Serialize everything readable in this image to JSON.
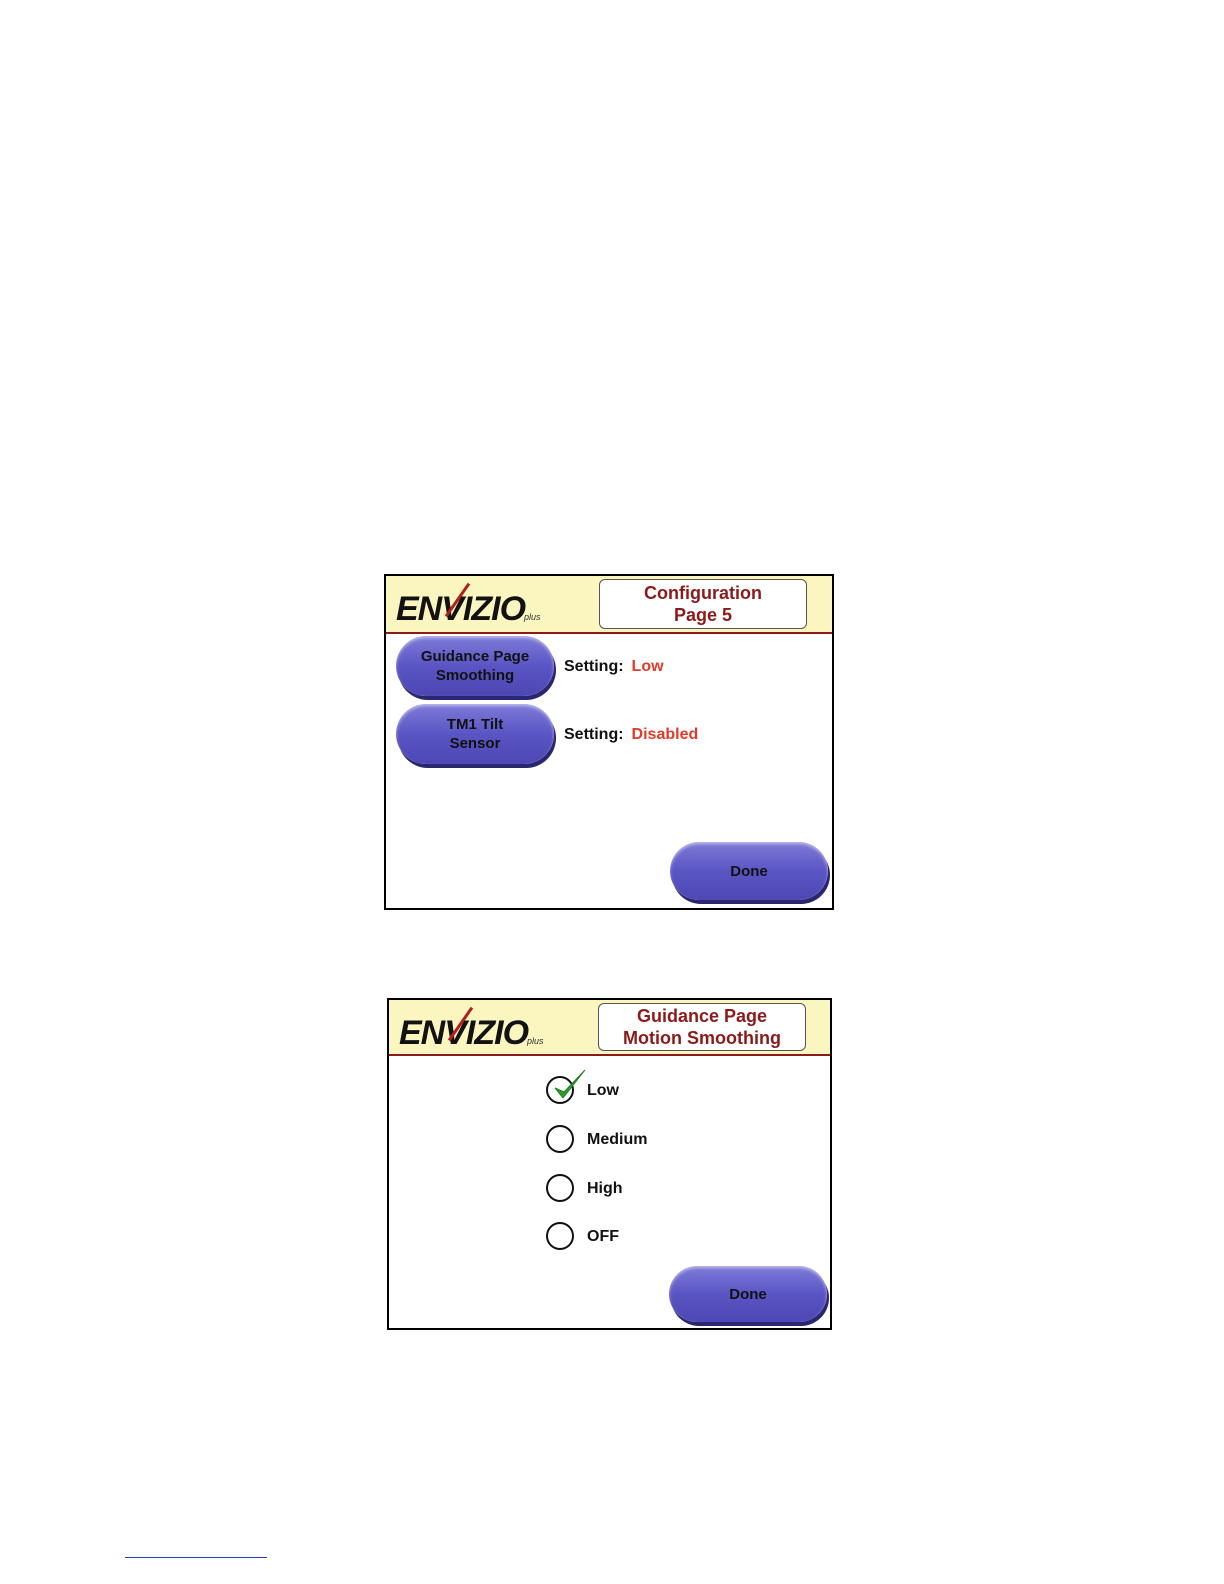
{
  "screen1": {
    "logo": "ENVIZIO",
    "logo_suffix": "plus",
    "title_line1": "Configuration",
    "title_line2": "Page 5",
    "buttons": [
      {
        "line1": "Guidance Page",
        "line2": "Smoothing"
      },
      {
        "line1": "TM1 Tilt",
        "line2": "Sensor"
      }
    ],
    "settings": [
      {
        "label": "Setting:",
        "value": "Low"
      },
      {
        "label": "Setting:",
        "value": "Disabled"
      }
    ],
    "done_label": "Done"
  },
  "screen2": {
    "logo": "ENVIZIO",
    "logo_suffix": "plus",
    "title_line1": "Guidance Page",
    "title_line2": "Motion Smoothing",
    "options": [
      {
        "label": "Low",
        "selected": true
      },
      {
        "label": "Medium",
        "selected": false
      },
      {
        "label": "High",
        "selected": false
      },
      {
        "label": "OFF",
        "selected": false
      }
    ],
    "done_label": "Done"
  },
  "colors": {
    "header_bg": "#fbf6c0",
    "title_text": "#8b1b1b",
    "value_text": "#e03a2a",
    "button": "#5a55c4",
    "check": "#2aa02a"
  }
}
